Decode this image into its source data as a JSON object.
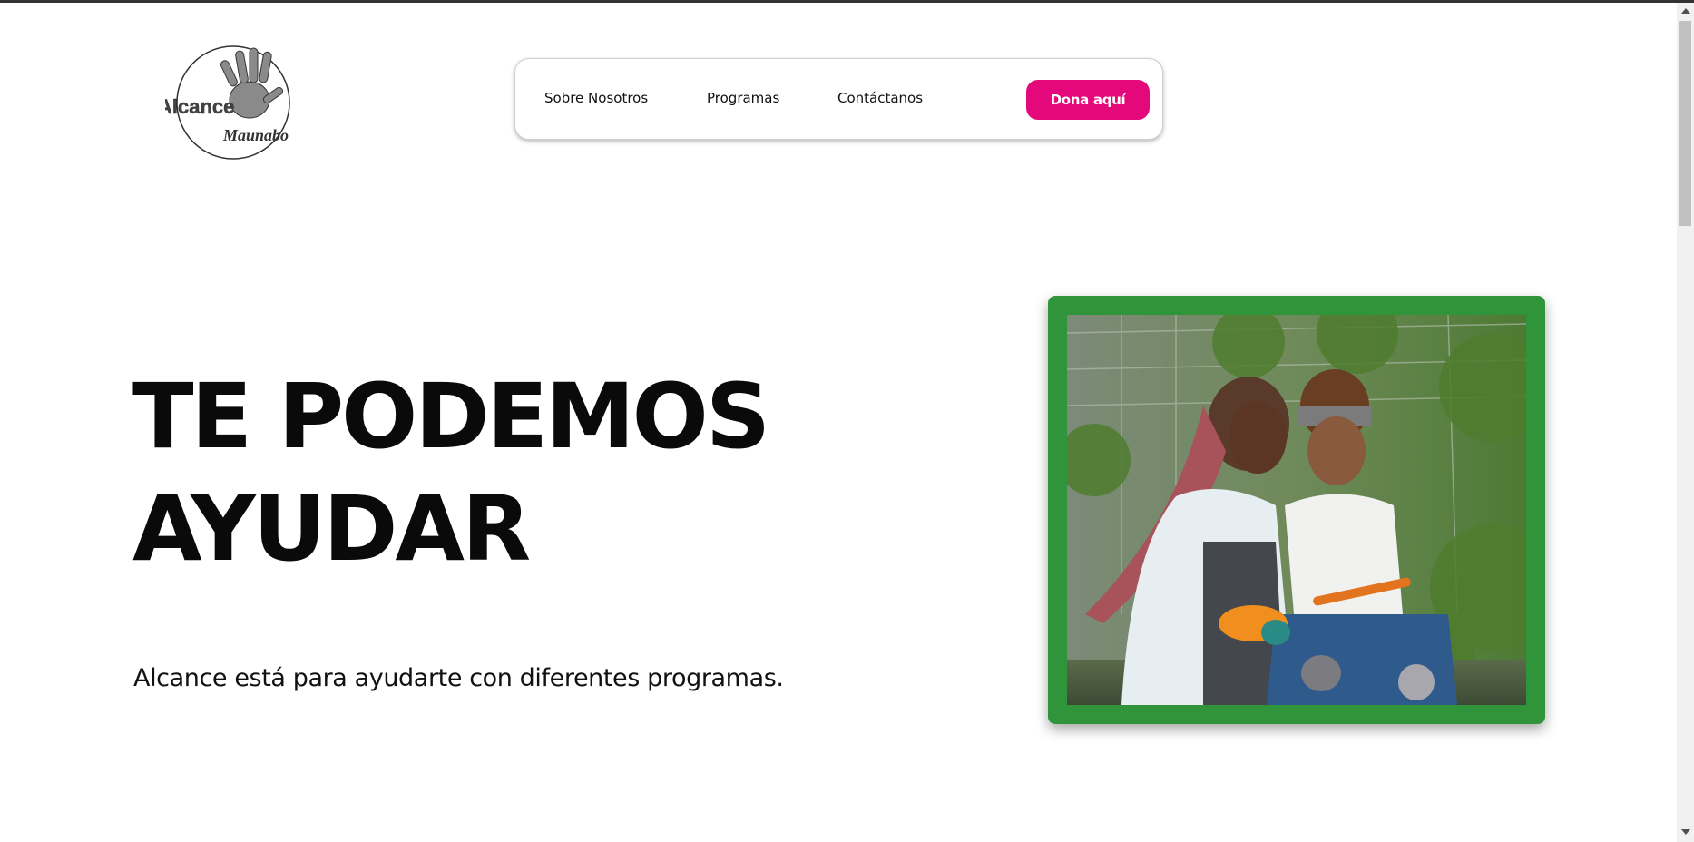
{
  "logo": {
    "name": "Alcance",
    "subtitle": "Maunabo",
    "icon": "hand-print-logo-icon"
  },
  "nav": {
    "links": [
      {
        "label": "Sobre Nosotros"
      },
      {
        "label": "Programas"
      },
      {
        "label": "Contáctanos"
      }
    ],
    "donate_label": "Dona aquí"
  },
  "hero": {
    "title_line1": "TE PODEMOS",
    "title_line2": "AYUDAR",
    "subtitle": "Alcance está para ayudarte con diferentes programas."
  },
  "photo": {
    "frame_color": "#2f943a",
    "subject": "two-women-gardening-photo"
  },
  "colors": {
    "accent": "#e5087a",
    "frame": "#2f943a"
  }
}
